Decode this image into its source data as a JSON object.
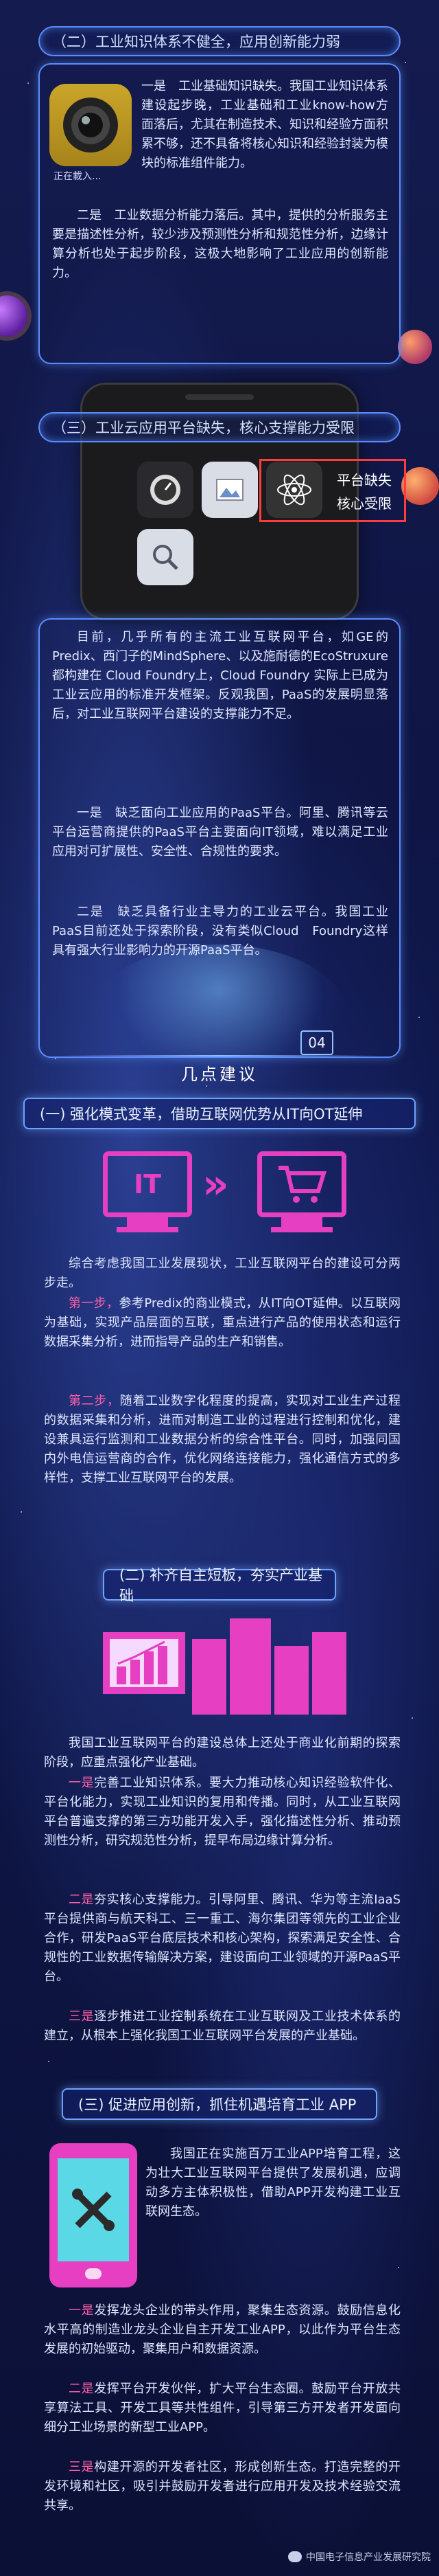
{
  "colors": {
    "accent": "#ff5fa8",
    "frame": "#5b8cff",
    "background": "#0d1238"
  },
  "section2": {
    "title": "（二）工业知识体系不健全，应用创新能力弱",
    "camera_caption": "正在載入...",
    "p1": "一是　工业基础知识缺失。我国工业知识体系建设起步晚，工业基础和工业know-how方面落后，尤其在制造技术、知识和经验方面积累不够，还不具备将核心知识和经验封装为模块的标准组件能力。",
    "p2": "二是　工业数据分析能力落后。其中，提供的分析服务主要是描述性分析，较少涉及预测性分析和规范性分析，边缘计算分析也处于起步阶段，这极大地影响了工业应用的创新能力。"
  },
  "section3": {
    "title": "（三）工业云应用平台缺失，核心支撑能力受限",
    "badge_line1": "平台缺失",
    "badge_line2": "核心受限",
    "p1": "目前，几乎所有的主流工业互联网平台，如GE的Predix、西门子的MindSphere、以及施耐德的EcoStruxure都构建在 Cloud Foundry上，Cloud Foundry 实际上已成为工业云应用的标准开发框架。反观我国，PaaS的发展明显落后，对工业互联网平台建设的支撑能力不足。",
    "p2": "一是　缺乏面向工业应用的PaaS平台。阿里、腾讯等云平台运营商提供的PaaS平台主要面向IT领域，难以满足工业应用对可扩展性、安全性、合规性的要求。",
    "p3": "二是　缺乏具备行业主导力的工业云平台。我国工业PaaS目前还处于探索阶段，没有类似Cloud　Foundry这样具有强大行业影响力的开源PaaS平台。"
  },
  "section4": {
    "number": "04",
    "title": "几点建议",
    "sub1": "(一) 强化模式变革，借助互联网优势从IT向OT延伸",
    "it_label": "IT",
    "s1p1": "综合考虑我国工业发展现状，工业互联网平台的建设可分两步走。",
    "s1p2_lead": "第一步，",
    "s1p2": "参考Predix的商业模式，从IT向OT延伸。以互联网为基础，实现产品层面的互联，重点进行产品的使用状态和运行数据采集分析，进而指导产品的生产和销售。",
    "s1p3_lead": "第二步，",
    "s1p3": "随着工业数字化程度的提高，实现对工业生产过程的数据采集和分析，进而对制造工业的过程进行控制和优化，建设兼具运行监测和工业数据分析的综合性平台。同时，加强同国内外电信运营商的合作，优化网络连接能力，强化通信方式的多样性，支撑工业互联网平台的发展。",
    "sub2": "(二) 补齐自主短板，夯实产业基础",
    "s2p1": "我国工业互联网平台的建设总体上还处于商业化前期的探索阶段，应重点强化产业基础。",
    "s2p2_lead": "一是",
    "s2p2": "完善工业知识体系。要大力推动核心知识经验软件化、平台化能力，实现工业知识的复用和传播。同时，从工业互联网平台普遍支撑的第三方功能开发入手，强化描述性分析、推动预测性分析，研究规范性分析，提早布局边缘计算分析。",
    "s2p3_lead": "二是",
    "s2p3": "夯实核心支撑能力。引导阿里、腾讯、华为等主流IaaS平台提供商与航天科工、三一重工、海尔集团等领先的工业企业合作，研发PaaS平台底层技术和核心架构，探索满足安全性、合规性的工业数据传输解决方案，建设面向工业领域的开源PaaS平台。",
    "s2p4_lead": "三是",
    "s2p4": "逐步推进工业控制系统在工业互联网及工业技术体系的建立，从根本上强化我国工业互联网平台发展的产业基础。",
    "sub3": "(三) 促进应用创新，抓住机遇培育工业 APP",
    "s3p1": "我国正在实施百万工业APP培育工程，这为壮大工业互联网平台提供了发展机遇，应调动多方主体积极性，借助APP开发构建工业互联网生态。",
    "s3p2_lead": "一是",
    "s3p2": "发挥龙头企业的带头作用，聚集生态资源。鼓励信息化水平高的制造业龙头企业自主开发工业APP，以此作为平台生态发展的初始驱动，聚集用户和数据资源。",
    "s3p3_lead": "二是",
    "s3p3": "发挥平台开发伙伴，扩大平台生态圈。鼓励平台开放共享算法工具、开发工具等共性组件，引导第三方开发者开发面向细分工业场景的新型工业APP。",
    "s3p4_lead": "三是",
    "s3p4": "构建开源的开发者社区，形成创新生态。打造完整的开发环境和社区，吸引并鼓励开发者进行应用开发及技术经验交流共享。"
  },
  "footer": {
    "watermark": "中国电子信息产业发展研究院"
  }
}
